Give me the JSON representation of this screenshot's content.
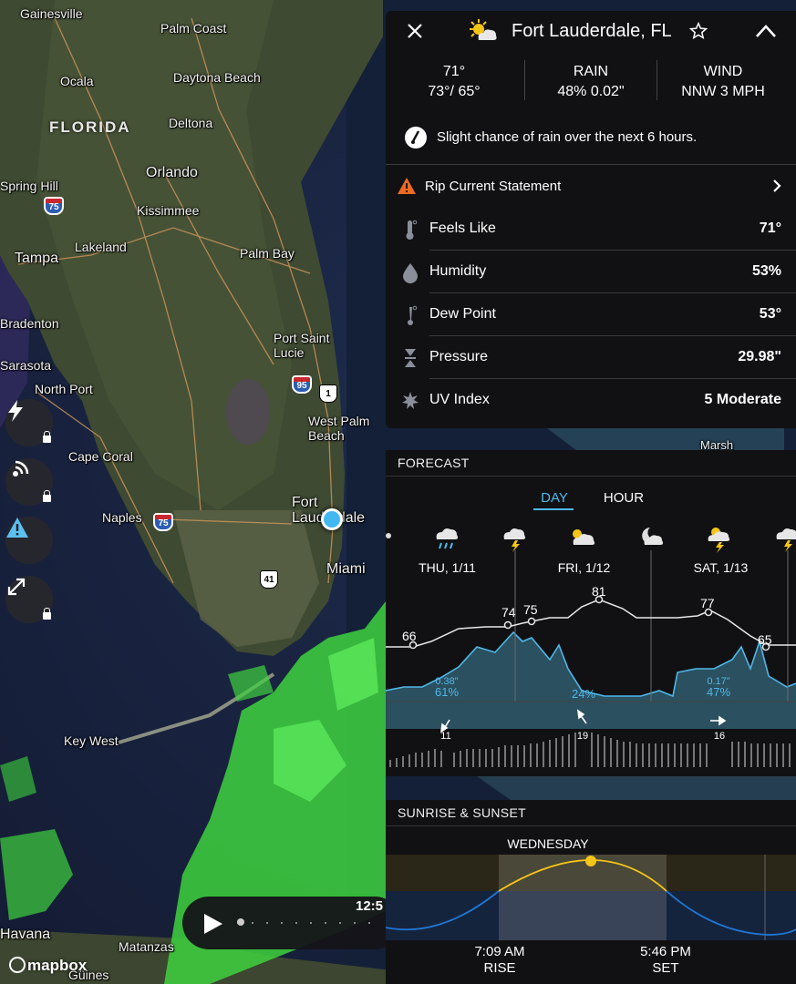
{
  "map": {
    "state_label": "FLORIDA",
    "cities": [
      {
        "name": "Gainesville"
      },
      {
        "name": "Palm Coast"
      },
      {
        "name": "Ocala"
      },
      {
        "name": "Daytona Beach"
      },
      {
        "name": "Deltona"
      },
      {
        "name": "Orlando"
      },
      {
        "name": "Spring Hill"
      },
      {
        "name": "Kissimmee"
      },
      {
        "name": "Lakeland"
      },
      {
        "name": "Tampa"
      },
      {
        "name": "Palm Bay"
      },
      {
        "name": "Bradenton"
      },
      {
        "name": "Sarasota"
      },
      {
        "name": "Port Saint Lucie"
      },
      {
        "name": "North Port"
      },
      {
        "name": "West Palm Beach"
      },
      {
        "name": "Cape Coral"
      },
      {
        "name": "Fort Lauderdale"
      },
      {
        "name": "Naples"
      },
      {
        "name": "Miami"
      },
      {
        "name": "Key West"
      },
      {
        "name": "Havana"
      },
      {
        "name": "Matanzas"
      },
      {
        "name": "Güines"
      }
    ],
    "shields": {
      "i75_a": "75",
      "i75_b": "75",
      "i95": "95",
      "us1": "1",
      "us41": "41"
    },
    "attribution": "mapbox",
    "playback_time": "12:5",
    "tools": [
      {
        "name": "lightning",
        "locked": true
      },
      {
        "name": "radar-layers",
        "locked": true
      },
      {
        "name": "alerts",
        "locked": false
      },
      {
        "name": "expand",
        "locked": true
      }
    ],
    "radar_color": "#3fd43f"
  },
  "current": {
    "location": "Fort Lauderdale, FL",
    "temp": "71°",
    "hi_lo": "73°/ 65°",
    "rain_label": "RAIN",
    "rain_value": "48% 0.02\"",
    "wind_label": "WIND",
    "wind_value": "NNW 3 MPH",
    "nowcast": "Slight chance of rain over the next 6 hours.",
    "alert": "Rip Current Statement",
    "alert_color": "#ef6a1f",
    "details": [
      {
        "label": "Feels Like",
        "value": "71°",
        "icon": "thermometer-icon"
      },
      {
        "label": "Humidity",
        "value": "53%",
        "icon": "drop-icon"
      },
      {
        "label": "Dew Point",
        "value": "53°",
        "icon": "dewpoint-icon"
      },
      {
        "label": "Pressure",
        "value": "29.98\"",
        "icon": "pressure-icon"
      },
      {
        "label": "UV Index",
        "value": "5 Moderate",
        "icon": "sun-uv-icon"
      }
    ]
  },
  "forecast": {
    "title": "FORECAST",
    "tabs": [
      "DAY",
      "HOUR"
    ],
    "active_tab": "DAY",
    "days": [
      "THU, 1/11",
      "FRI, 1/12",
      "SAT, 1/13"
    ],
    "temp_labels": [
      "66",
      "74",
      "75",
      "81",
      "77",
      "65"
    ],
    "precip": [
      {
        "amount": "0.38\"",
        "chance": "61%"
      },
      {
        "amount": "",
        "chance": "24%"
      },
      {
        "amount": "0.17\"",
        "chance": "47%"
      }
    ],
    "winds": [
      "11",
      "19",
      "16"
    ],
    "accent": "#4fb8e8"
  },
  "sun": {
    "title": "SUNRISE & SUNSET",
    "day": "WEDNESDAY",
    "rise_time": "7:09 AM",
    "rise_label": "RISE",
    "set_time": "5:46 PM",
    "set_label": "SET"
  },
  "markers": {
    "partial": "Marsh"
  }
}
